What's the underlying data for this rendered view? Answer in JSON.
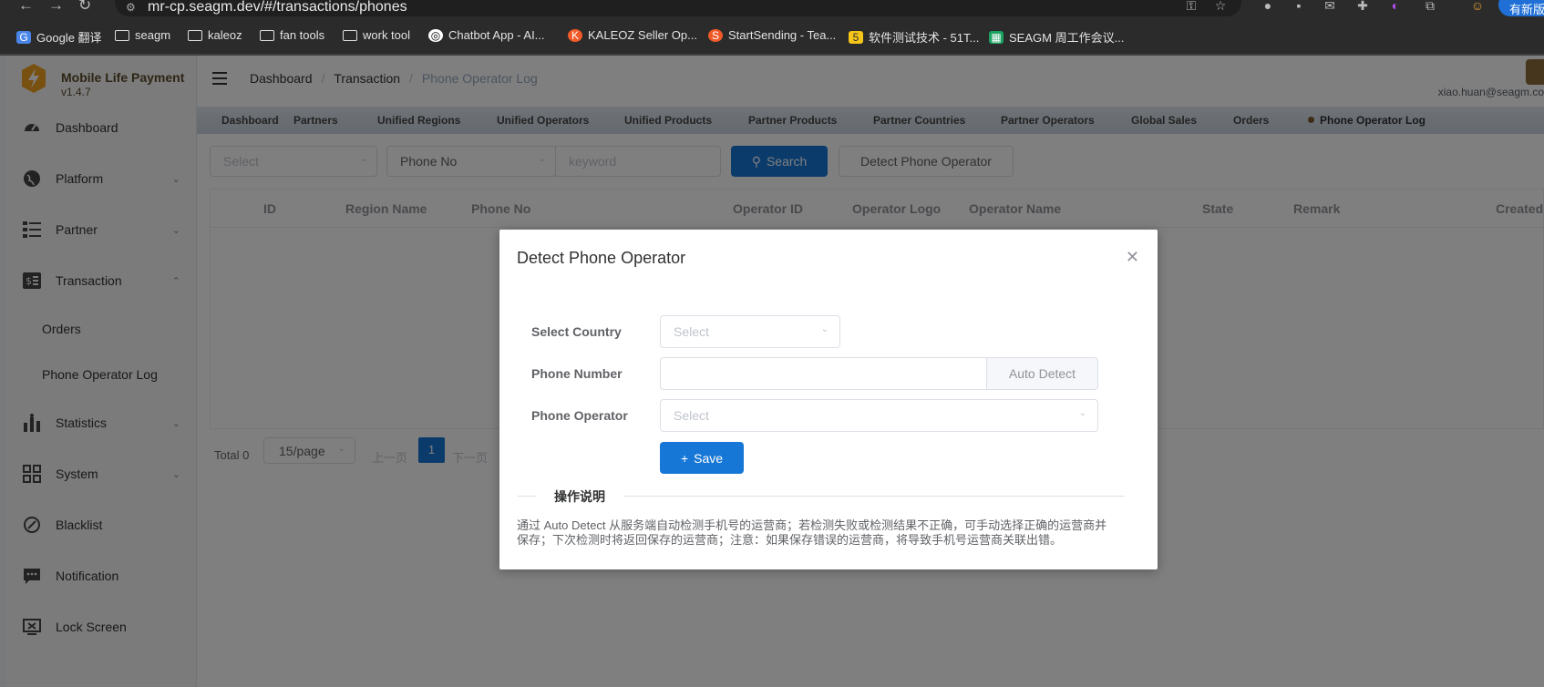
{
  "browser": {
    "url": "mr-cp.seagm.dev/#/transactions/phones",
    "update_label": "有新版",
    "bookmarks": [
      {
        "label": "Google 翻译",
        "icon": "google-translate-icon"
      },
      {
        "label": "seagm",
        "icon": "folder-icon"
      },
      {
        "label": "kaleoz",
        "icon": "folder-icon"
      },
      {
        "label": "fan tools",
        "icon": "folder-icon"
      },
      {
        "label": "work tool",
        "icon": "folder-icon"
      },
      {
        "label": "Chatbot App - AI...",
        "icon": "chatbot-icon"
      },
      {
        "label": "KALEOZ Seller Op...",
        "icon": "kaleoz-icon"
      },
      {
        "label": "StartSending - Tea...",
        "icon": "startsending-icon"
      },
      {
        "label": "软件测试技术 - 51T...",
        "icon": "51t-icon"
      },
      {
        "label": "SEAGM 周工作会议...",
        "icon": "sheet-icon"
      }
    ]
  },
  "brand": {
    "name": "Mobile Life Payment",
    "version": "v1.4.7"
  },
  "sidebar": {
    "items": [
      {
        "label": "Dashboard",
        "icon": "dashboard-icon"
      },
      {
        "label": "Platform",
        "icon": "globe-icon"
      },
      {
        "label": "Partner",
        "icon": "list-icon"
      },
      {
        "label": "Transaction",
        "icon": "money-icon"
      },
      {
        "label": "Statistics",
        "icon": "statistics-icon"
      },
      {
        "label": "System",
        "icon": "system-icon"
      },
      {
        "label": "Blacklist",
        "icon": "blacklist-icon"
      },
      {
        "label": "Notification",
        "icon": "notification-icon"
      },
      {
        "label": "Lock Screen",
        "icon": "lock-screen-icon"
      }
    ],
    "sub_items": [
      "Orders",
      "Phone Operator Log"
    ]
  },
  "header": {
    "breadcrumbs": [
      "Dashboard",
      "Transaction",
      "Phone Operator Log"
    ],
    "user_email": "xiao.huan@seagm.co"
  },
  "tags": [
    "Dashboard",
    "Partners",
    "Unified Regions",
    "Unified Operators",
    "Unified Products",
    "Partner Products",
    "Partner Countries",
    "Partner Operators",
    "Global Sales",
    "Orders",
    "Phone Operator Log"
  ],
  "filters": {
    "select_placeholder": "Select",
    "phone_select": "Phone No",
    "keyword_placeholder": "keyword",
    "search_label": "Search",
    "detect_label": "Detect Phone Operator"
  },
  "table": {
    "columns": [
      "ID",
      "Region Name",
      "Phone No",
      "Operator ID",
      "Operator Logo",
      "Operator Name",
      "State",
      "Remark",
      "Created"
    ]
  },
  "pagination": {
    "total": "Total 0",
    "page_size": "15/page",
    "prev": "上一页",
    "current": "1",
    "next": "下一页"
  },
  "dialog": {
    "title": "Detect Phone Operator",
    "country_label": "Select Country",
    "country_placeholder": "Select",
    "phone_label": "Phone Number",
    "phone_value": "",
    "auto_detect_label": "Auto Detect",
    "operator_label": "Phone Operator",
    "operator_placeholder": "Select",
    "save_label": "Save",
    "instructions_title": "操作说明",
    "instructions_text": "通过 Auto Detect 从服务端自动检测手机号的运营商；若检测失败或检测结果不正确，可手动选择正确的运营商并保存；下次检测时将返回保存的运营商；注意：如果保存错误的运营商，将导致手机号运营商关联出错。"
  },
  "colors": {
    "primary": "#1677d6",
    "brand": "#5a4a2c"
  }
}
